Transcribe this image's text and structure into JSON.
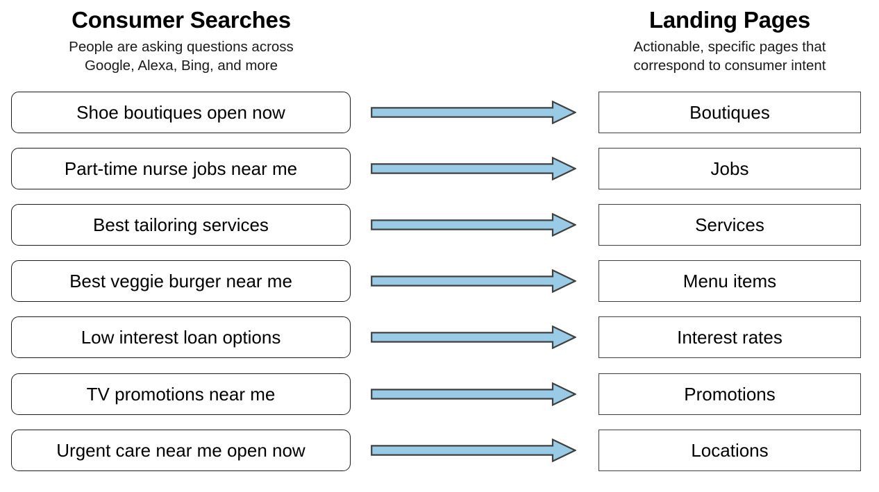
{
  "columns": {
    "left": {
      "title": "Consumer Searches",
      "subtitle_lines": [
        "People are asking questions across",
        "Google, Alexa, Bing, and more"
      ]
    },
    "right": {
      "title": "Landing Pages",
      "subtitle_lines": [
        "Actionable, specific pages that",
        "correspond to consumer intent"
      ]
    }
  },
  "colors": {
    "arrow_fill": "#9ACBE6",
    "arrow_stroke": "#404040",
    "left_box_border": "#1a1a1a",
    "right_box_border": "#3d3d3d",
    "background": "#ffffff",
    "text": "#000000"
  },
  "arrow_icon_name": "right-arrow-icon",
  "rows": [
    {
      "search": "Shoe boutiques open now",
      "landing": "Boutiques"
    },
    {
      "search": "Part-time nurse jobs near me",
      "landing": "Jobs"
    },
    {
      "search": "Best tailoring services",
      "landing": "Services"
    },
    {
      "search": "Best veggie burger near me",
      "landing": "Menu items"
    },
    {
      "search": "Low interest loan options",
      "landing": "Interest rates"
    },
    {
      "search": "TV promotions near me",
      "landing": "Promotions"
    },
    {
      "search": "Urgent care near me open now",
      "landing": "Locations"
    }
  ]
}
